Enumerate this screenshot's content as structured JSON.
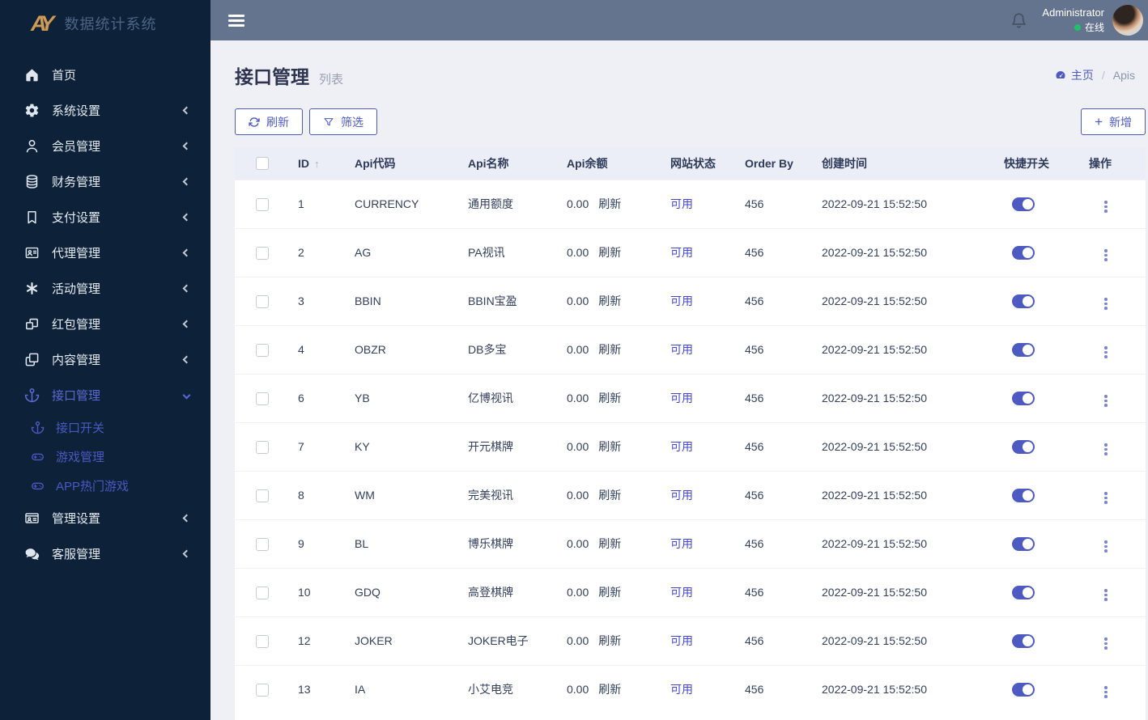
{
  "colors": {
    "accent": "#4d5ac2",
    "link": "#4349cf",
    "sidebar_bg": "#0d2239",
    "topbar_bg": "#64748e",
    "content_bg": "#eef0f6",
    "status_green": "#1fc26a"
  },
  "brand": {
    "logo": "AY",
    "title": "数据统计系统"
  },
  "topbar": {
    "menu_icon": "hamburger",
    "bell_icon": "bell",
    "user": {
      "name": "Administrator",
      "status": "在线"
    }
  },
  "sidebar": {
    "items": [
      {
        "key": "home",
        "label": "首页",
        "icon": "home",
        "chevron": "none"
      },
      {
        "key": "system-settings",
        "label": "系统设置",
        "icon": "cogs",
        "chevron": "left"
      },
      {
        "key": "member-management",
        "label": "会员管理",
        "icon": "user",
        "chevron": "left"
      },
      {
        "key": "finance-management",
        "label": "财务管理",
        "icon": "database",
        "chevron": "left"
      },
      {
        "key": "payment-settings",
        "label": "支付设置",
        "icon": "bookmark",
        "chevron": "left"
      },
      {
        "key": "agent-management",
        "label": "代理管理",
        "icon": "address-card",
        "chevron": "left"
      },
      {
        "key": "activity-management",
        "label": "活动管理",
        "icon": "asterisk",
        "chevron": "left"
      },
      {
        "key": "redpacket-management",
        "label": "红包管理",
        "icon": "cubes",
        "chevron": "left"
      },
      {
        "key": "content-management",
        "label": "内容管理",
        "icon": "clone",
        "chevron": "left"
      },
      {
        "key": "api-management",
        "label": "接口管理",
        "icon": "anchor",
        "chevron": "down",
        "active": true,
        "children": [
          {
            "key": "api-switch",
            "label": "接口开关",
            "icon": "anchor"
          },
          {
            "key": "game-management",
            "label": "游戏管理",
            "icon": "gamepad"
          },
          {
            "key": "app-hot-games",
            "label": "APP热门游戏",
            "icon": "gamepad"
          }
        ]
      },
      {
        "key": "admin-settings",
        "label": "管理设置",
        "icon": "id-card",
        "chevron": "left"
      },
      {
        "key": "support-management",
        "label": "客服管理",
        "icon": "comments",
        "chevron": "left"
      }
    ]
  },
  "page": {
    "title": "接口管理",
    "subtitle": "列表",
    "breadcrumb": {
      "home_icon": "dashboard",
      "home": "主页",
      "separator": "/",
      "current": "Apis"
    }
  },
  "toolbar": {
    "refresh_icon": "refresh",
    "refresh_label": "刷新",
    "filter_icon": "funnel",
    "filter_label": "筛选",
    "add_icon": "plus",
    "add_label": "新增"
  },
  "table": {
    "headers": [
      {
        "key": "checkbox",
        "label": ""
      },
      {
        "key": "id",
        "label": "ID",
        "sortable": true
      },
      {
        "key": "code",
        "label": "Api代码"
      },
      {
        "key": "name",
        "label": "Api名称"
      },
      {
        "key": "balance",
        "label": "Api余额"
      },
      {
        "key": "status",
        "label": "网站状态"
      },
      {
        "key": "order",
        "label": "Order By"
      },
      {
        "key": "created",
        "label": "创建时间"
      },
      {
        "key": "switch",
        "label": "快捷开关"
      },
      {
        "key": "actions",
        "label": "操作"
      }
    ],
    "refresh_link_label": "刷新",
    "rows": [
      {
        "id": "1",
        "code": "CURRENCY",
        "name": "通用额度",
        "balance": "0.00",
        "status": "可用",
        "order": "456",
        "created": "2022-09-21 15:52:50",
        "enabled": true
      },
      {
        "id": "2",
        "code": "AG",
        "name": "PA视讯",
        "balance": "0.00",
        "status": "可用",
        "order": "456",
        "created": "2022-09-21 15:52:50",
        "enabled": true
      },
      {
        "id": "3",
        "code": "BBIN",
        "name": "BBIN宝盈",
        "balance": "0.00",
        "status": "可用",
        "order": "456",
        "created": "2022-09-21 15:52:50",
        "enabled": true
      },
      {
        "id": "4",
        "code": "OBZR",
        "name": "DB多宝",
        "balance": "0.00",
        "status": "可用",
        "order": "456",
        "created": "2022-09-21 15:52:50",
        "enabled": true
      },
      {
        "id": "6",
        "code": "YB",
        "name": "亿博视讯",
        "balance": "0.00",
        "status": "可用",
        "order": "456",
        "created": "2022-09-21 15:52:50",
        "enabled": true
      },
      {
        "id": "7",
        "code": "KY",
        "name": "开元棋牌",
        "balance": "0.00",
        "status": "可用",
        "order": "456",
        "created": "2022-09-21 15:52:50",
        "enabled": true
      },
      {
        "id": "8",
        "code": "WM",
        "name": "完美视讯",
        "balance": "0.00",
        "status": "可用",
        "order": "456",
        "created": "2022-09-21 15:52:50",
        "enabled": true
      },
      {
        "id": "9",
        "code": "BL",
        "name": "博乐棋牌",
        "balance": "0.00",
        "status": "可用",
        "order": "456",
        "created": "2022-09-21 15:52:50",
        "enabled": true
      },
      {
        "id": "10",
        "code": "GDQ",
        "name": "高登棋牌",
        "balance": "0.00",
        "status": "可用",
        "order": "456",
        "created": "2022-09-21 15:52:50",
        "enabled": true
      },
      {
        "id": "12",
        "code": "JOKER",
        "name": "JOKER电子",
        "balance": "0.00",
        "status": "可用",
        "order": "456",
        "created": "2022-09-21 15:52:50",
        "enabled": true
      },
      {
        "id": "13",
        "code": "IA",
        "name": "小艾电竞",
        "balance": "0.00",
        "status": "可用",
        "order": "456",
        "created": "2022-09-21 15:52:50",
        "enabled": true
      }
    ]
  }
}
